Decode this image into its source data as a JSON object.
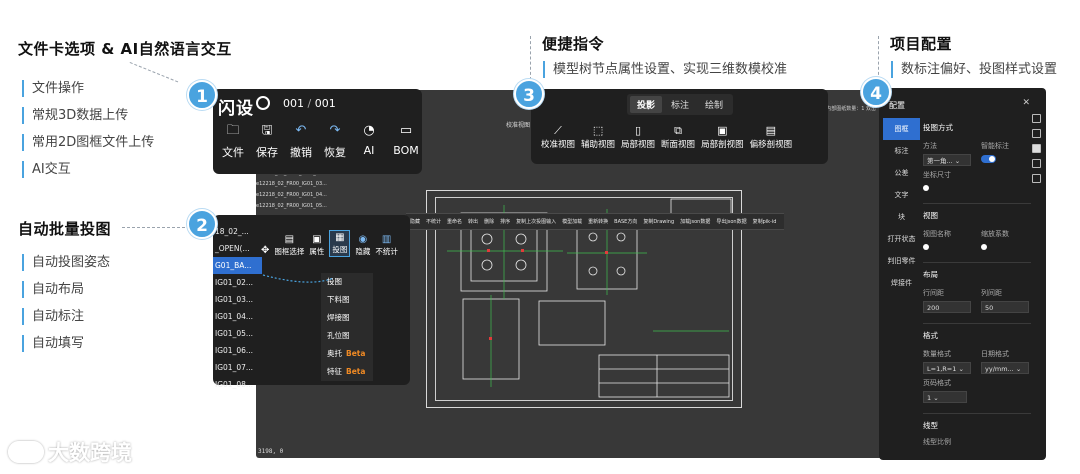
{
  "sections": {
    "s1": {
      "number": "1",
      "heading": "文件卡选项 & AI自然语言交互",
      "items": [
        "文件操作",
        "常规3D数据上传",
        "常用2D图框文件上传",
        "AI交互"
      ]
    },
    "s2": {
      "number": "2",
      "heading": "自动批量投图",
      "items": [
        "自动投图姿态",
        "自动布局",
        "自动标注",
        "自动填写"
      ]
    },
    "s3": {
      "number": "3",
      "heading": "便捷指令",
      "items": [
        "模型树节点属性设置、实现三维数模校准"
      ]
    },
    "s4": {
      "number": "4",
      "heading": "项目配置",
      "items": [
        "数标注偏好、投图样式设置"
      ]
    }
  },
  "file_card": {
    "title": "闪设",
    "pager_current": "001",
    "pager_sep": "/",
    "pager_total": "001",
    "tools": [
      {
        "icon": "folder-icon",
        "label": "文件"
      },
      {
        "icon": "save-icon",
        "label": "保存"
      },
      {
        "icon": "undo-icon",
        "label": "撤销"
      },
      {
        "icon": "redo-icon",
        "label": "恢复"
      },
      {
        "icon": "ai-icon",
        "label": "AI"
      },
      {
        "icon": "bom-icon",
        "label": "BOM"
      }
    ]
  },
  "file_list_bg": [
    "e12218_02_FR00_IG01_02...",
    "e12218_02_FR00_IG01_03...",
    "e12218_02_FR00_IG01_04...",
    "e12218_02_FR00_IG01_05..."
  ],
  "batch": {
    "list": [
      "18_02_...",
      "_OPEN(...",
      "G01_BA...",
      "IG01_02...",
      "IG01_03...",
      "IG01_04...",
      "IG01_05...",
      "IG01_06...",
      "IG01_07...",
      "IG01_08..."
    ],
    "selected_index": 2,
    "toolbar": [
      {
        "icon": "frame-select-icon",
        "label": "图框选择"
      },
      {
        "icon": "property-icon",
        "label": "属性"
      },
      {
        "icon": "projection-icon",
        "label": "投图"
      },
      {
        "icon": "hide-icon",
        "label": "隐藏"
      },
      {
        "icon": "no-stat-icon",
        "label": "不统计"
      }
    ],
    "menu": [
      {
        "label": "投图",
        "beta": ""
      },
      {
        "label": "下料图",
        "beta": ""
      },
      {
        "label": "焊接图",
        "beta": ""
      },
      {
        "label": "孔位图",
        "beta": ""
      },
      {
        "label": "奥托",
        "beta": "Beta"
      },
      {
        "label": "特征",
        "beta": "Beta"
      }
    ]
  },
  "ribbon": [
    "隐藏",
    "不统计",
    "重命名",
    "转出",
    "删除",
    "排序",
    "复制上次投图输入",
    "模型加载",
    "重新转换",
    "BASE方向",
    "复制Drawing",
    "加载json数据",
    "导出json数据",
    "复制pik-id"
  ],
  "quick": {
    "tabs": [
      "投影",
      "标注",
      "绘制"
    ],
    "active_tab": 0,
    "tools": [
      {
        "icon": "calibrate-view-icon",
        "label": "校准视图"
      },
      {
        "icon": "aux-view-icon",
        "label": "辅助视图"
      },
      {
        "icon": "partial-view-icon",
        "label": "局部视图"
      },
      {
        "icon": "section-view-icon",
        "label": "断面视图"
      },
      {
        "icon": "partial-section-icon",
        "label": "局部剖视图"
      },
      {
        "icon": "offset-section-icon",
        "label": "偏移剖视图"
      }
    ]
  },
  "cad": {
    "top_icon_label": "校准视图",
    "top_right": "内部图纸数量：1 双击",
    "status": "3198, 0"
  },
  "config": {
    "title": "配置",
    "nav": [
      "图框",
      "标注",
      "公差",
      "文字",
      "块",
      "打开状态",
      "判旧零件",
      "焊接件"
    ],
    "active_nav": 0,
    "proj_title": "投图方式",
    "method_label": "方法",
    "method_value": "第一角...",
    "smart_label": "智能标注",
    "coord_label": "坐标尺寸",
    "view_title": "视图",
    "view_name_label": "视图名称",
    "scale_label": "缩放系数",
    "layout_title": "布局",
    "row_gap_label": "行间距",
    "row_gap_value": "200",
    "col_gap_label": "列间距",
    "col_gap_value": "50",
    "format_title": "格式",
    "num_format_label": "数量格式",
    "num_format_value": "L=1,R=1",
    "date_format_label": "日期格式",
    "date_format_value": "yy/mm...",
    "page_format_label": "页码格式",
    "page_format_value": "1",
    "line_title": "线型",
    "line_scale_label": "线型比例"
  },
  "watermark": "大数跨境"
}
